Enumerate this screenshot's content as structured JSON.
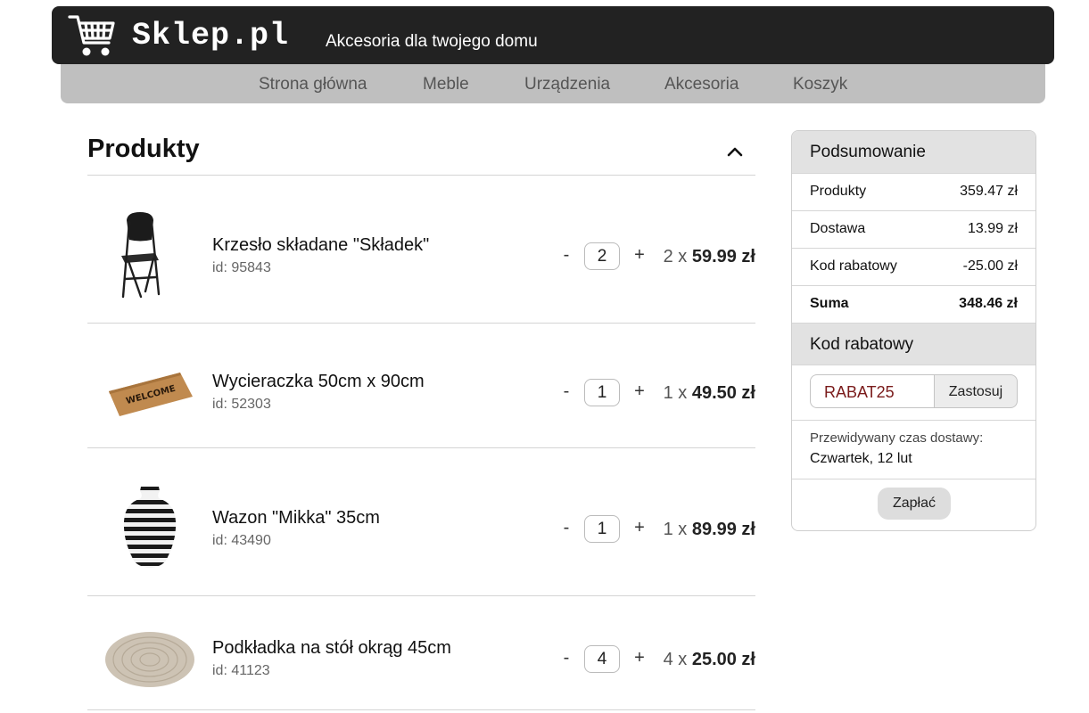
{
  "header": {
    "brand": "Sklep.pl",
    "tagline": "Akcesoria dla twojego domu",
    "logo_icon": "shopping-cart-icon"
  },
  "nav": {
    "items": [
      "Strona główna",
      "Meble",
      "Urządzenia",
      "Akcesoria",
      "Koszyk"
    ]
  },
  "products": {
    "title": "Produkty",
    "collapse_icon": "chevron-up-icon",
    "items": [
      {
        "name": "Krzesło składane \"Składek\"",
        "id": "id: 95843",
        "qty": "2",
        "minus": "-",
        "plus": "+",
        "qty_prefix": "2 x",
        "price": "59.99 zł"
      },
      {
        "name": "Wycieraczka 50cm x 90cm",
        "id": "id: 52303",
        "qty": "1",
        "minus": "-",
        "plus": "+",
        "qty_prefix": "1 x",
        "price": "49.50 zł",
        "image_text": "WELCOME"
      },
      {
        "name": "Wazon \"Mikka\" 35cm",
        "id": "id: 43490",
        "qty": "1",
        "minus": "-",
        "plus": "+",
        "qty_prefix": "1 x",
        "price": "89.99 zł"
      },
      {
        "name": "Podkładka na stół okrąg 45cm",
        "id": "id: 41123",
        "qty": "4",
        "minus": "-",
        "plus": "+",
        "qty_prefix": "4 x",
        "price": "25.00 zł"
      }
    ]
  },
  "summary": {
    "title": "Podsumowanie",
    "rows": [
      {
        "label": "Produkty",
        "value": "359.47 zł"
      },
      {
        "label": "Dostawa",
        "value": "13.99 zł"
      },
      {
        "label": "Kod rabatowy",
        "value": "-25.00 zł"
      },
      {
        "label": "Suma",
        "value": "348.46 zł"
      }
    ],
    "coupon_title": "Kod rabatowy",
    "coupon_value": "RABAT25",
    "apply_label": "Zastosuj",
    "delivery_label": "Przewidywany czas dostawy:",
    "delivery_value": "Czwartek, 12 lut",
    "pay_label": "Zapłać"
  }
}
